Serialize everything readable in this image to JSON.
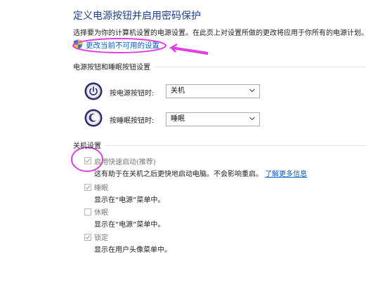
{
  "header": {
    "title": "定义电源按钮并启用密码保护",
    "description": "选择要为你的计算机设置的电源设置。在此页上对设置所做的更改将应用于你所有的电源计划。",
    "change_link": "更改当前不可用的设置"
  },
  "power_section": {
    "heading": "电源按钮和睡眠按钮设置",
    "rows": [
      {
        "label": "按电源按钮时:",
        "value": "关机",
        "icon": "power-button-icon"
      },
      {
        "label": "按睡眠按钮时:",
        "value": "睡眠",
        "icon": "sleep-button-icon"
      }
    ]
  },
  "shutdown_section": {
    "heading": "关机设置",
    "options": [
      {
        "label": "启用快速启动(推荐)",
        "checked": true,
        "description": "这有助于在关机之后更快地启动电脑。不会影响重启。",
        "link": "了解更多信息"
      },
      {
        "label": "睡眠",
        "checked": true,
        "description": "显示在“电源”菜单中。"
      },
      {
        "label": "休眠",
        "checked": false,
        "description": "显示在“电源”菜单中。"
      },
      {
        "label": "锁定",
        "checked": true,
        "description": "显示在用户头像菜单中。"
      }
    ]
  },
  "colors": {
    "title": "#1e3f8a",
    "link": "#0a5cc7",
    "annotation": "#e040e0"
  }
}
